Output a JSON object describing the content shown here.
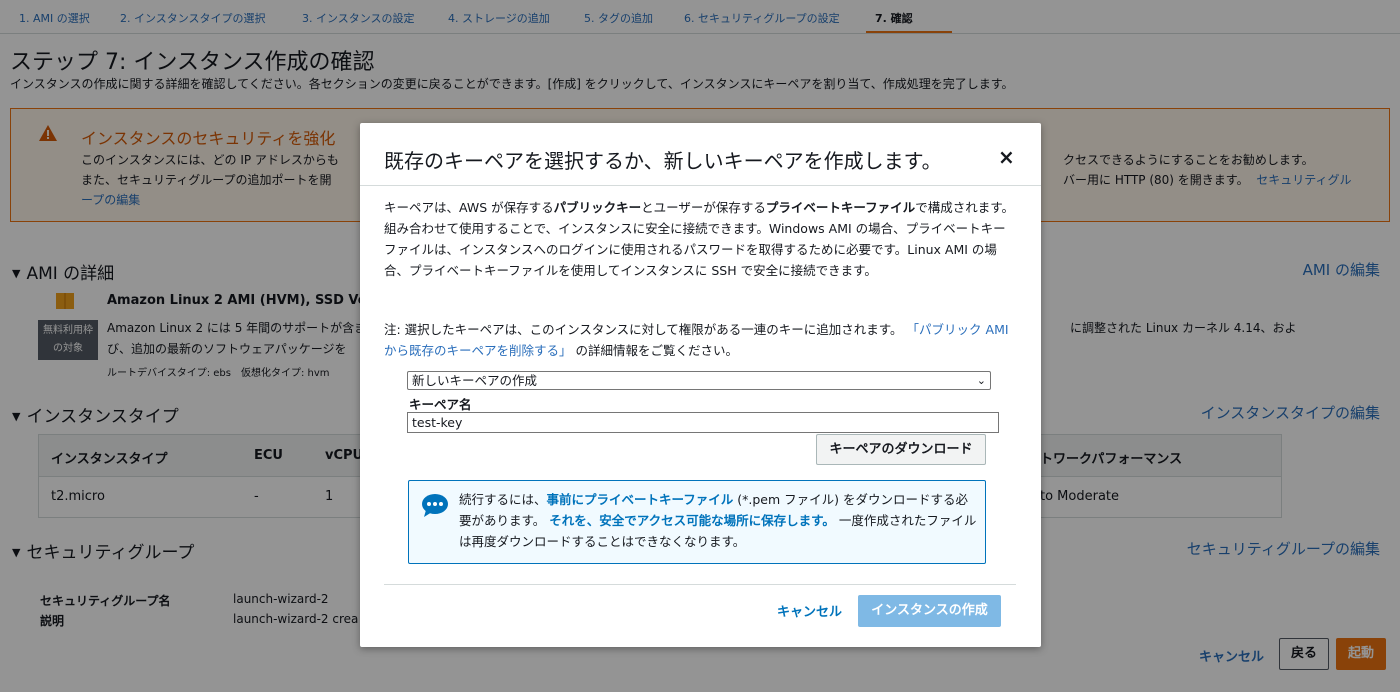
{
  "tabs": [
    {
      "label": "1. AMI の選択"
    },
    {
      "label": "2. インスタンスタイプの選択"
    },
    {
      "label": "3. インスタンスの設定"
    },
    {
      "label": "4. ストレージの追加"
    },
    {
      "label": "5. タグの追加"
    },
    {
      "label": "6. セキュリティグループの設定"
    },
    {
      "label": "7. 確認"
    }
  ],
  "page": {
    "title": "ステップ 7: インスタンス作成の確認",
    "description": "インスタンスの作成に関する詳細を確認してください。各セクションの変更に戻ることができます。[作成] をクリックして、インスタンスにキーペアを割り当て、作成処理を完了します。"
  },
  "warning": {
    "title": "インスタンスのセキュリティを強化",
    "line1": "このインスタンスには、どの IP アドレスからも",
    "line2": "また、セキュリティグループの追加ポートを開",
    "right1": "クセスできるようにすることをお勧めします。",
    "right2": "バー用に HTTP (80) を開きます。",
    "link_part1": "セキュリティグル",
    "link_part2": "ープの編集"
  },
  "ami_section": {
    "heading": "AMI の詳細",
    "edit_link": "AMI の編集",
    "name": "Amazon Linux 2 AMI (HVM), SSD Vol",
    "desc1": "Amazon Linux 2 には 5 年間のサポートが含ま",
    "desc2": "び、追加の最新のソフトウェアパッケージを",
    "meta": "ルートデバイスタイプ: ebs　仮想化タイプ: hvm",
    "right": "に調整された Linux カーネル 4.14、およ",
    "badge_line1": "無料利用枠",
    "badge_line2": "の対象"
  },
  "instance_section": {
    "heading": "インスタンスタイプ",
    "edit_link": "インスタンスタイプの編集",
    "columns": [
      "インスタンスタイプ",
      "ECU",
      "vCPU",
      "トワークパフォーマンス"
    ],
    "row": [
      "t2.micro",
      "-",
      "1",
      "to Moderate"
    ]
  },
  "sg_section": {
    "heading": "セキュリティグループ",
    "edit_link": "セキュリティグループの編集",
    "name_label": "セキュリティグループ名",
    "name_value": "launch-wizard-2",
    "desc_label": "説明",
    "desc_value": "launch-wizard-2 crea"
  },
  "footer": {
    "cancel": "キャンセル",
    "back": "戻る",
    "launch": "起動"
  },
  "modal": {
    "title": "既存のキーペアを選択するか、新しいキーペアを作成します。",
    "close": "×",
    "para1_a": "キーペアは、AWS が保存する",
    "para1_b": "パブリックキー",
    "para1_c": "とユーザーが保存する",
    "para1_d": "プライベートキーファイル",
    "para1_e": "で構成されます。組み合わせて使用することで、インスタンスに安全に接続できます。Windows AMI の場合、プライベートキーファイルは、インスタンスへのログインに使用されるパスワードを取得するために必要です。Linux AMI の場合、プライベートキーファイルを使用してインスタンスに SSH で安全に接続できます。",
    "para2_a": "注: 選択したキーペアは、このインスタンスに対して権限がある一連のキーに追加されます。",
    "para2_link": "「パブリック AMI から既存のキーペアを削除する」",
    "para2_b": "の詳細情報をご覧ください。",
    "select_value": "新しいキーペアの作成",
    "key_name_label": "キーペア名",
    "key_name_value": "test-key",
    "download_button": "キーペアのダウンロード",
    "info_a": "続行するには、",
    "info_b": "事前にプライベートキーファイル",
    "info_c": "(*.pem ファイル) をダウンロードする必要があります。",
    "info_d": "それを、安全でアクセス可能な場所に保存します。",
    "info_e": "一度作成されたファイルは再度ダウンロードすることはできなくなります。",
    "cancel_button": "キャンセル",
    "create_button": "インスタンスの作成"
  },
  "colors": {
    "accent": "#ec7211",
    "link": "#0073bb",
    "warning_bg": "#fef4e9",
    "info_bg": "#f1faff",
    "create_disabled": "#7fb9e5"
  }
}
